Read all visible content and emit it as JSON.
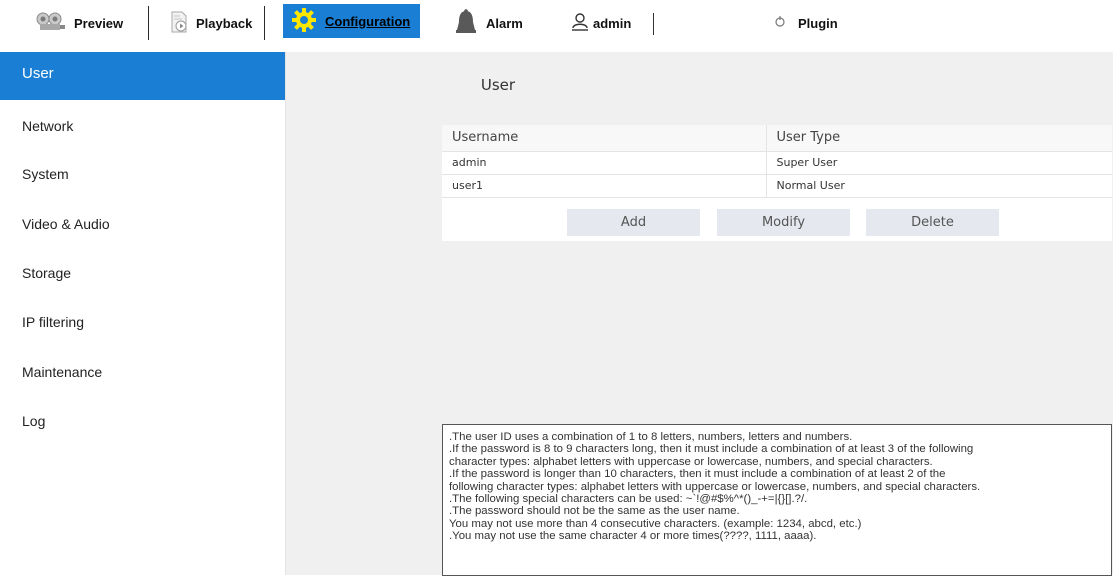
{
  "topbar": {
    "preview_label": "Preview",
    "playback_label": "Playback",
    "configuration_label": "Configuration",
    "alarm_label": "Alarm",
    "user_label": "admin",
    "plugin_label": "Plugin"
  },
  "sidebar": {
    "items": [
      {
        "label": "User",
        "active": true
      },
      {
        "label": "Network"
      },
      {
        "label": "System"
      },
      {
        "label": "Video & Audio"
      },
      {
        "label": "Storage"
      },
      {
        "label": "IP filtering"
      },
      {
        "label": "Maintenance"
      },
      {
        "label": "Log"
      }
    ]
  },
  "main": {
    "title": "User",
    "table": {
      "headers": [
        "Username",
        "User Type"
      ],
      "rows": [
        [
          "admin",
          "Super User"
        ],
        [
          "user1",
          "Normal User"
        ]
      ]
    },
    "buttons": {
      "add": "Add",
      "modify": "Modify",
      "delete": "Delete"
    },
    "notes": [
      ".The user ID uses a combination of 1 to 8 letters, numbers, letters and numbers.",
      ".If the password is 8 to 9 characters long, then it must include a combination of at least 3 of the following",
      "character types: alphabet letters with uppercase or lowercase, numbers, and special characters.",
      ".If the password is longer than 10 characters, then it must include a combination of at least 2 of the",
      "following character types: alphabet letters with uppercase or lowercase, numbers, and special characters.",
      ".The following special characters can be used: ~`!@#$%^*()_-+=|{}[].?/.",
      ".The password should not be the same as the user name.",
      "You may not use more than 4 consecutive characters. (example: 1234, abcd, etc.)",
      ".You may not use the same character 4 or more times(????, 1111, aaaa)."
    ]
  },
  "colors": {
    "accent": "#1a7fd4",
    "content_bg": "#f0f0f0",
    "button_bg": "#e5e8ef"
  }
}
